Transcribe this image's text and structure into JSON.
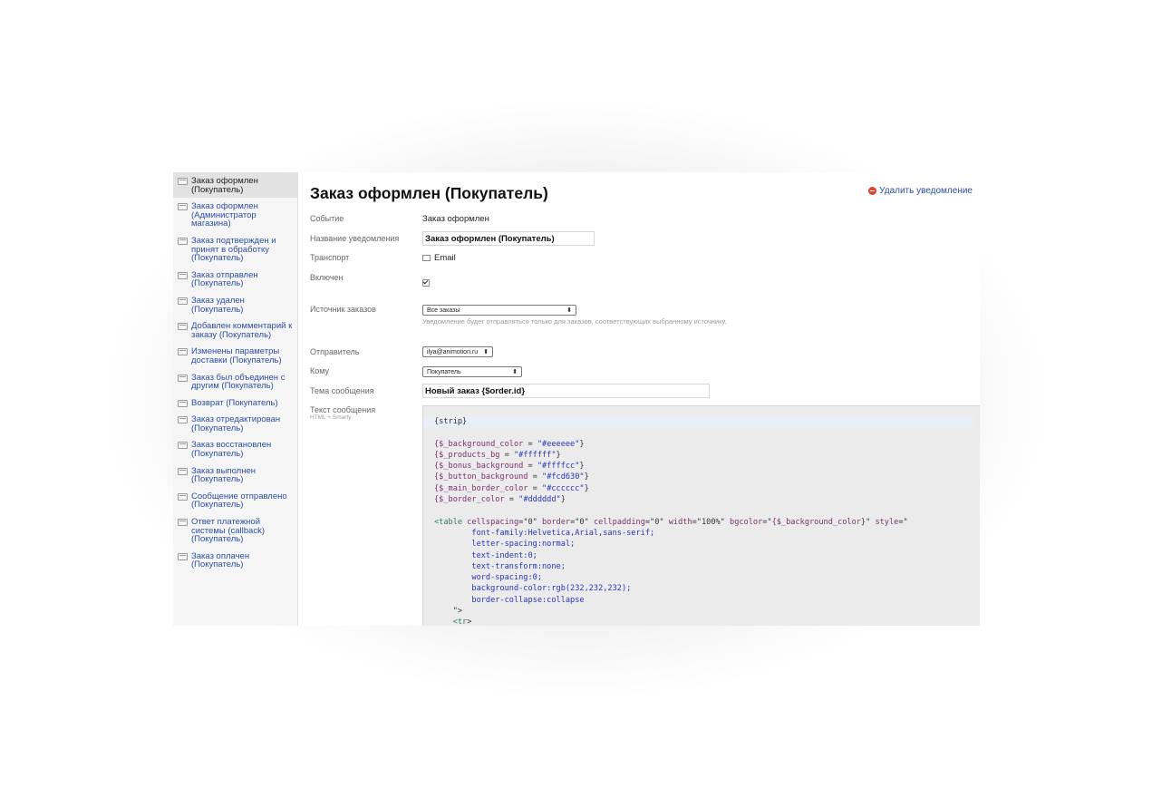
{
  "sidebar": {
    "items": [
      {
        "label": "Заказ оформлен (Покупатель)",
        "lines": [
          "Заказ оформлен",
          "(Покупатель)"
        ],
        "active": true
      },
      {
        "label": "Заказ оформлен (Администратор магазина)",
        "lines": [
          "Заказ оформлен",
          "(Администратор",
          "магазина)"
        ]
      },
      {
        "label": "Заказ подтвержден и принят в обработку (Покупатель)",
        "lines": [
          "Заказ подтвержден и",
          "принят в обработку",
          "(Покупатель)"
        ]
      },
      {
        "label": "Заказ отправлен (Покупатель)",
        "lines": [
          "Заказ отправлен",
          "(Покупатель)"
        ]
      },
      {
        "label": "Заказ удален (Покупатель)",
        "lines": [
          "Заказ удален",
          "(Покупатель)"
        ]
      },
      {
        "label": "Добавлен комментарий к заказу (Покупатель)",
        "lines": [
          "Добавлен комментарий к",
          "заказу (Покупатель)"
        ]
      },
      {
        "label": "Изменены параметры доставки (Покупатель)",
        "lines": [
          "Изменены параметры",
          "доставки (Покупатель)"
        ]
      },
      {
        "label": "Заказ был объединен с другим (Покупатель)",
        "lines": [
          "Заказ был объединен с",
          "другим (Покупатель)"
        ]
      },
      {
        "label": "Возврат (Покупатель)",
        "lines": [
          "Возврат (Покупатель)"
        ]
      },
      {
        "label": "Заказ отредактирован (Покупатель)",
        "lines": [
          "Заказ отредактирован",
          "(Покупатель)"
        ]
      },
      {
        "label": "Заказ восстановлен (Покупатель)",
        "lines": [
          "Заказ восстановлен",
          "(Покупатель)"
        ]
      },
      {
        "label": "Заказ выполнен (Покупатель)",
        "lines": [
          "Заказ выполнен",
          "(Покупатель)"
        ]
      },
      {
        "label": "Сообщение отправлено (Покупатель)",
        "lines": [
          "Сообщение отправлено",
          "(Покупатель)"
        ]
      },
      {
        "label": "Ответ платежной системы (callback) (Покупатель)",
        "lines": [
          "Ответ платежной",
          "системы (callback)",
          "(Покупатель)"
        ]
      },
      {
        "label": "Заказ оплачен (Покупатель)",
        "lines": [
          "Заказ оплачен",
          "(Покупатель)"
        ]
      }
    ]
  },
  "main": {
    "title": "Заказ оформлен (Покупатель)",
    "delete_label": "Удалить уведомление",
    "fields": {
      "event_label": "Событие",
      "event_value": "Заказ оформлен",
      "name_label": "Название уведомления",
      "name_value": "Заказ оформлен (Покупатель)",
      "transport_label": "Транспорт",
      "transport_value": "Email",
      "enabled_label": "Включен",
      "enabled_checked": true,
      "source_label": "Источник заказов",
      "source_value": "Все заказы",
      "source_hint": "Уведомление будет отправляться только для заказов, соответствующих выбранному источнику.",
      "sender_label": "Отправитель",
      "sender_value": "ilya@animotion.ru",
      "to_label": "Кому",
      "to_value": "Покупатель",
      "subject_label": "Тема сообщения",
      "subject_value": "Новый заказ {$order.id}",
      "body_label": "Текст сообщения",
      "body_sublabel": "HTML + Smarty"
    },
    "code_lines": [
      "{strip}",
      "",
      "{$_background_color = \"#eeeeee\"}",
      "{$_products_bg = \"#ffffff\"}",
      "{$_bonus_background = \"#ffffcc\"}",
      "{$_button_background = \"#fcd630\"}",
      "{$_main_border_color = \"#cccccc\"}",
      "{$_border_color = \"#dddddd\"}",
      "",
      "<table cellspacing=\"0\" border=\"0\" cellpadding=\"0\" width=\"100%\" bgcolor=\"{$_background_color}\" style=\"",
      "        font-family:Helvetica,Arial,sans-serif;",
      "        letter-spacing:normal;",
      "        text-indent:0;",
      "        text-transform:none;",
      "        word-spacing:0;",
      "        background-color:rgb(232,232,232);",
      "        border-collapse:collapse",
      "    \">",
      "    <tr>"
    ]
  }
}
